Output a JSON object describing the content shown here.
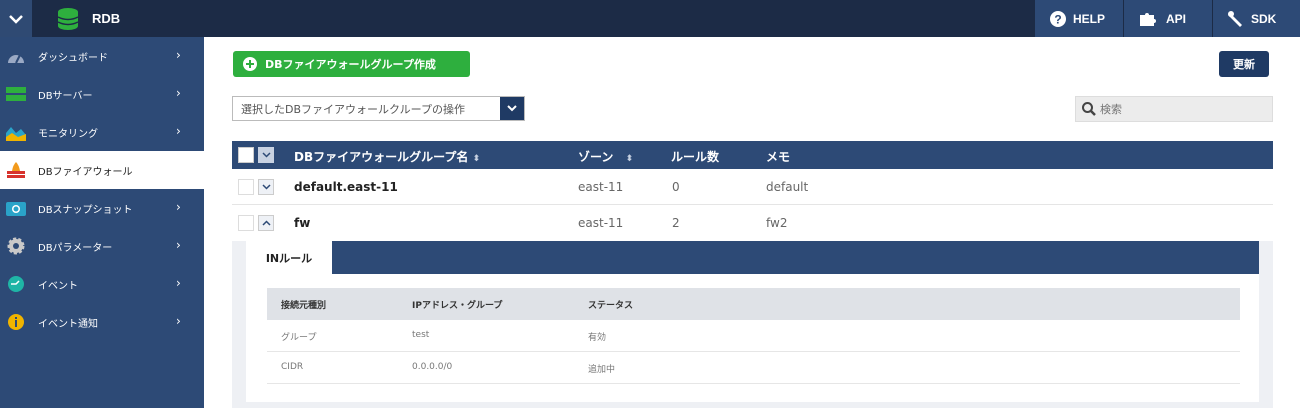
{
  "topbar": {
    "app_title": "RDB",
    "links": [
      {
        "label": "HELP"
      },
      {
        "label": "API"
      },
      {
        "label": "SDK"
      }
    ]
  },
  "sidebar": {
    "items": [
      {
        "label": "ダッシュボード",
        "icon": "dashboard-gauge-icon",
        "color": "#9aa9c4",
        "has_chevron": true
      },
      {
        "label": "DBサーバー",
        "icon": "db-server-icon",
        "color": "#2eaf3e",
        "has_chevron": true
      },
      {
        "label": "モニタリング",
        "icon": "monitoring-chart-icon",
        "color": "#f0b400",
        "has_chevron": true
      },
      {
        "label": "DBファイアウォール",
        "icon": "firewall-icon",
        "color": "#d7322c",
        "has_chevron": false,
        "active": true
      },
      {
        "label": "DBスナップショット",
        "icon": "camera-icon",
        "color": "#2aa3c9",
        "has_chevron": true
      },
      {
        "label": "DBパラメーター",
        "icon": "gear-icon",
        "color": "#c9c9c9",
        "has_chevron": true
      },
      {
        "label": "イベント",
        "icon": "event-clock-icon",
        "color": "#1fb5a6",
        "has_chevron": true
      },
      {
        "label": "イベント通知",
        "icon": "info-icon",
        "color": "#f0b400",
        "has_chevron": true
      }
    ]
  },
  "toolbar": {
    "create_label": "DBファイアウォールグループ作成",
    "refresh_label": "更新",
    "operations_label": "選択したDBファイアウォールクループの操作",
    "search_placeholder": "検索"
  },
  "table": {
    "headers": {
      "name": "DBファイアウォールグループ名",
      "zone": "ゾーン",
      "rules": "ルール数",
      "memo": "メモ"
    },
    "rows": [
      {
        "name": "default.east-11",
        "zone": "east-11",
        "rules": "0",
        "memo": "default",
        "expanded": false
      },
      {
        "name": "fw",
        "zone": "east-11",
        "rules": "2",
        "memo": "fw2",
        "expanded": true
      }
    ]
  },
  "detail": {
    "tab_label": "INルール",
    "headers": {
      "source_type": "接続元種別",
      "ip_group": "IPアドレス・グループ",
      "status": "ステータス"
    },
    "rows": [
      {
        "source_type": "グループ",
        "ip_group": "test",
        "status": "有効"
      },
      {
        "source_type": "CIDR",
        "ip_group": "0.0.0.0/0",
        "status": "追加中"
      }
    ]
  },
  "colors": {
    "navy": "#1c2b46",
    "blue": "#2d4a76",
    "green": "#2eaf3e"
  }
}
